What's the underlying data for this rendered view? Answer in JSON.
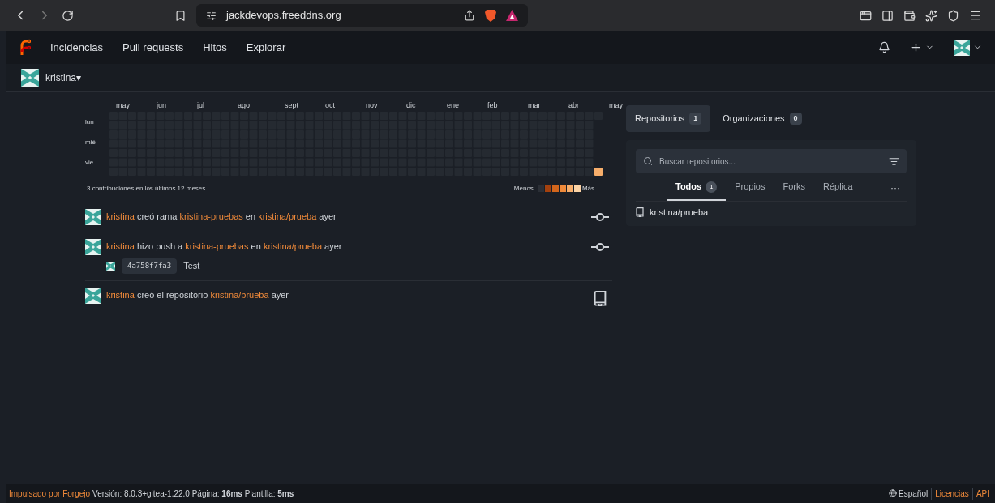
{
  "browser": {
    "url": "jackdevops.freeddns.org"
  },
  "navbar": {
    "items": [
      {
        "label": "Incidencias"
      },
      {
        "label": "Pull requests"
      },
      {
        "label": "Hitos"
      },
      {
        "label": "Explorar"
      }
    ]
  },
  "context": {
    "user": "kristina",
    "caret": "▾"
  },
  "heatmap": {
    "months": [
      "may",
      "jun",
      "jul",
      "ago",
      "sept",
      "oct",
      "nov",
      "dic",
      "ene",
      "feb",
      "mar",
      "abr",
      "may"
    ],
    "days": [
      "lun",
      "mié",
      "vie"
    ],
    "summary": "3 contribuciones en los últimos 12 meses",
    "legend_less": "Menos",
    "legend_more": "Más",
    "cells": [
      {
        "color": "#f7ae6b"
      }
    ]
  },
  "feed": [
    {
      "kind": "commit",
      "parts": [
        {
          "kind": "link",
          "text": "kristina"
        },
        {
          "kind": "text",
          "text": "creó rama"
        },
        {
          "kind": "link",
          "text": "kristina-pruebas"
        },
        {
          "kind": "text",
          "text": "en"
        },
        {
          "kind": "link",
          "text": "kristina/prueba"
        },
        {
          "kind": "text",
          "text": "ayer"
        }
      ]
    },
    {
      "kind": "commit",
      "parts": [
        {
          "kind": "link",
          "text": "kristina"
        },
        {
          "kind": "text",
          "text": "hizo push a"
        },
        {
          "kind": "link",
          "text": "kristina-pruebas"
        },
        {
          "kind": "text",
          "text": "en"
        },
        {
          "kind": "link",
          "text": "kristina/prueba"
        },
        {
          "kind": "text",
          "text": "ayer"
        }
      ],
      "commits": [
        {
          "sha": "4a758f7fa3",
          "message": "Test"
        }
      ]
    },
    {
      "kind": "repo",
      "parts": [
        {
          "kind": "link",
          "text": "kristina"
        },
        {
          "kind": "text",
          "text": "creó el repositorio"
        },
        {
          "kind": "link",
          "text": "kristina/prueba"
        },
        {
          "kind": "text",
          "text": "ayer"
        }
      ]
    }
  ],
  "sidebar": {
    "tabs": [
      {
        "label": "Repositorios",
        "count": "1",
        "selected": true
      },
      {
        "label": "Organizaciones",
        "count": "0",
        "selected": false
      }
    ],
    "search": {
      "placeholder": "Buscar repositorios..."
    },
    "filters": [
      {
        "label": "Todos",
        "count": "1",
        "selected": true
      },
      {
        "label": "Propios",
        "selected": false
      },
      {
        "label": "Forks",
        "selected": false
      },
      {
        "label": "Réplica",
        "selected": false
      }
    ],
    "more": "···",
    "repos": [
      {
        "name": "kristina/prueba"
      }
    ]
  },
  "footer": {
    "powered": "Impulsado por Forgejo",
    "info": "Versión: 8.0.3+gitea-1.22.0 Página: **16ms** Plantilla: **5ms**",
    "language": "Español",
    "links": [
      "Licencias",
      "API"
    ]
  }
}
